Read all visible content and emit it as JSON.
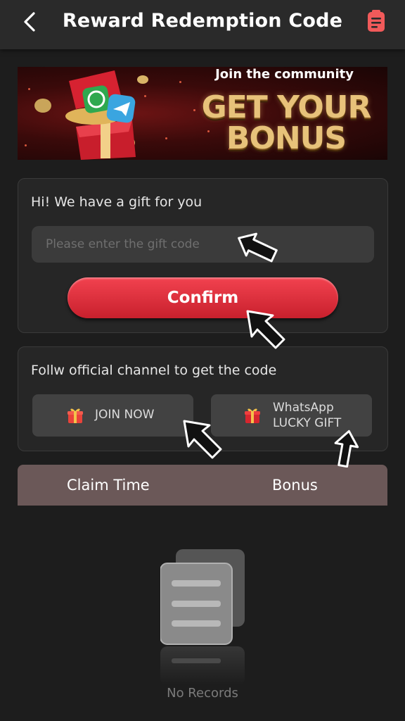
{
  "header": {
    "title": "Reward Redemption Code",
    "back_icon": "chevron-left-icon",
    "record_icon": "document-icon",
    "record_color": "#f15a5a"
  },
  "banner": {
    "subtitle": "Join the community",
    "title": "GET YOUR BONUS"
  },
  "gift_card": {
    "greeting": "Hi! We have a gift for you",
    "input_placeholder": "Please enter the gift code",
    "input_value": "",
    "confirm_label": "Confirm"
  },
  "channel_card": {
    "title": "Follw official channel to get the code",
    "join_label": "JOIN NOW",
    "whatsapp_label_1": "WhatsApp",
    "whatsapp_label_2": "LUCKY GIFT"
  },
  "records": {
    "col_time": "Claim Time",
    "col_bonus": "Bonus",
    "empty_text": "No Records"
  },
  "colors": {
    "accent": "#e0303d",
    "background": "#1d1d1d",
    "table_header": "#6b5858"
  }
}
